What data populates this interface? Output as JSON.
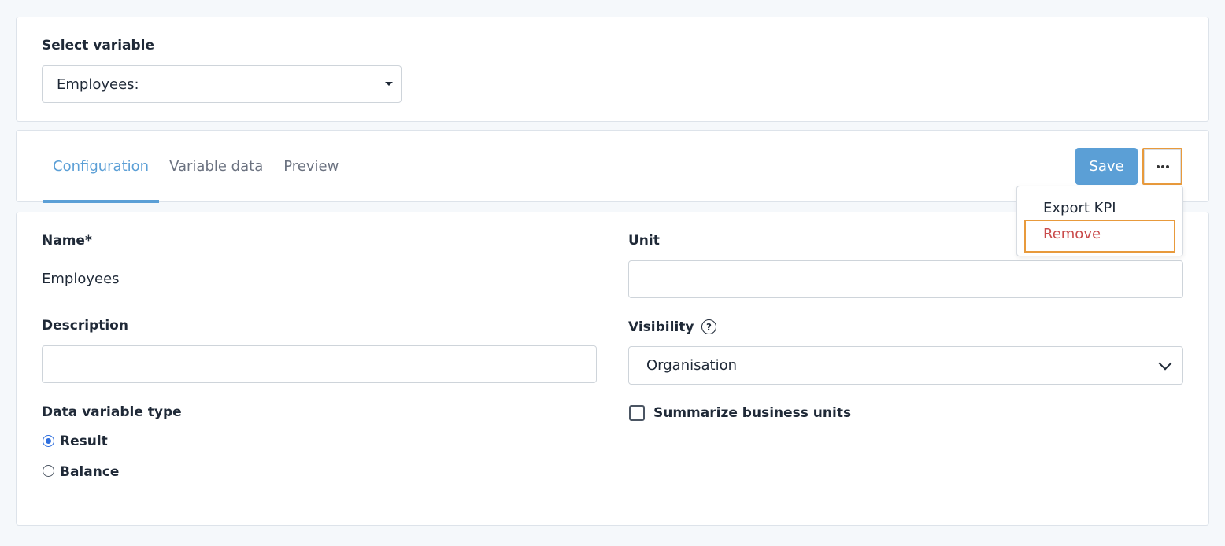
{
  "select_variable": {
    "label": "Select variable",
    "selected": "Employees:"
  },
  "tabs": [
    {
      "label": "Configuration",
      "active": true
    },
    {
      "label": "Variable data",
      "active": false
    },
    {
      "label": "Preview",
      "active": false
    }
  ],
  "toolbar": {
    "save_label": "Save",
    "more_icon": "ellipsis-icon"
  },
  "more_menu": {
    "items": [
      {
        "label": "Export KPI"
      },
      {
        "label": "Remove"
      }
    ]
  },
  "form": {
    "name": {
      "label": "Name*",
      "value": "Employees"
    },
    "unit": {
      "label": "Unit",
      "value": ""
    },
    "description": {
      "label": "Description",
      "value": ""
    },
    "visibility": {
      "label": "Visibility",
      "value": "Organisation",
      "help_icon": "question-circle-icon"
    },
    "data_variable_type": {
      "label": "Data variable type",
      "options": [
        {
          "label": "Result",
          "checked": true
        },
        {
          "label": "Balance",
          "checked": false
        }
      ]
    },
    "summarize": {
      "label": "Summarize business units",
      "checked": false
    }
  },
  "colors": {
    "accent": "#5b9fd6",
    "highlight": "#e89a3c",
    "danger": "#c94b4b",
    "radio_checked": "#2f6fde"
  }
}
